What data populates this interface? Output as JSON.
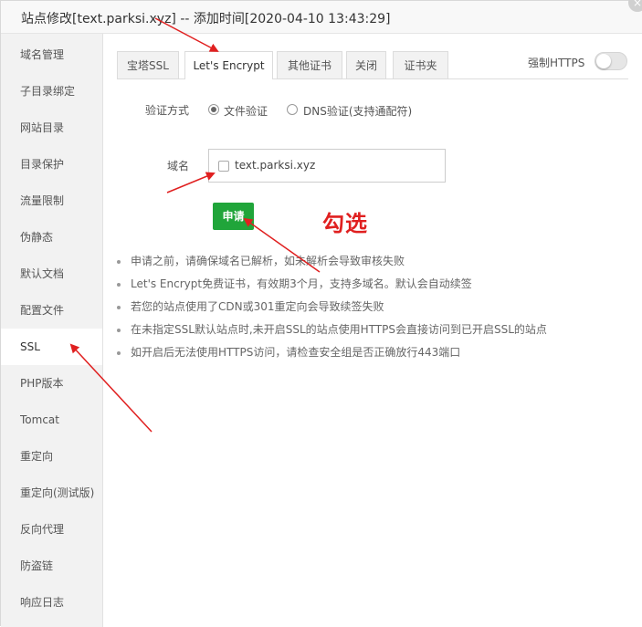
{
  "window": {
    "title": "站点修改[text.parksi.xyz] -- 添加时间[2020-04-10 13:43:29]",
    "close_glyph": "×"
  },
  "sidebar": {
    "items": [
      {
        "label": "域名管理"
      },
      {
        "label": "子目录绑定"
      },
      {
        "label": "网站目录"
      },
      {
        "label": "目录保护"
      },
      {
        "label": "流量限制"
      },
      {
        "label": "伪静态"
      },
      {
        "label": "默认文档"
      },
      {
        "label": "配置文件"
      },
      {
        "label": "SSL",
        "active": true
      },
      {
        "label": "PHP版本"
      },
      {
        "label": "Tomcat"
      },
      {
        "label": "重定向"
      },
      {
        "label": "重定向(测试版)"
      },
      {
        "label": "反向代理"
      },
      {
        "label": "防盗链"
      },
      {
        "label": "响应日志"
      }
    ]
  },
  "tabs": [
    {
      "label": "宝塔SSL"
    },
    {
      "label": "Let's Encrypt",
      "active": true
    },
    {
      "label": "其他证书"
    },
    {
      "label": "关闭"
    },
    {
      "label": "证书夹"
    }
  ],
  "force_https": {
    "label": "强制HTTPS",
    "enabled": false
  },
  "verify": {
    "label": "验证方式",
    "options": [
      {
        "label": "文件验证",
        "selected": true
      },
      {
        "label": "DNS验证(支持通配符)",
        "selected": false
      }
    ]
  },
  "domain": {
    "label": "域名",
    "items": [
      {
        "name": "text.parksi.xyz",
        "checked": false
      }
    ]
  },
  "apply_button": {
    "label": "申请"
  },
  "annotation": {
    "text": "勾选",
    "color": "#e02020"
  },
  "tips": [
    "申请之前，请确保域名已解析，如未解析会导致审核失败",
    "Let's Encrypt免费证书，有效期3个月，支持多域名。默认会自动续签",
    "若您的站点使用了CDN或301重定向会导致续签失败",
    "在未指定SSL默认站点时,未开启SSL的站点使用HTTPS会直接访问到已开启SSL的站点",
    "如开启后无法使用HTTPS访问，请检查安全组是否正确放行443端口"
  ],
  "colors": {
    "primary_green": "#20a53a",
    "annotation_red": "#e02020"
  }
}
